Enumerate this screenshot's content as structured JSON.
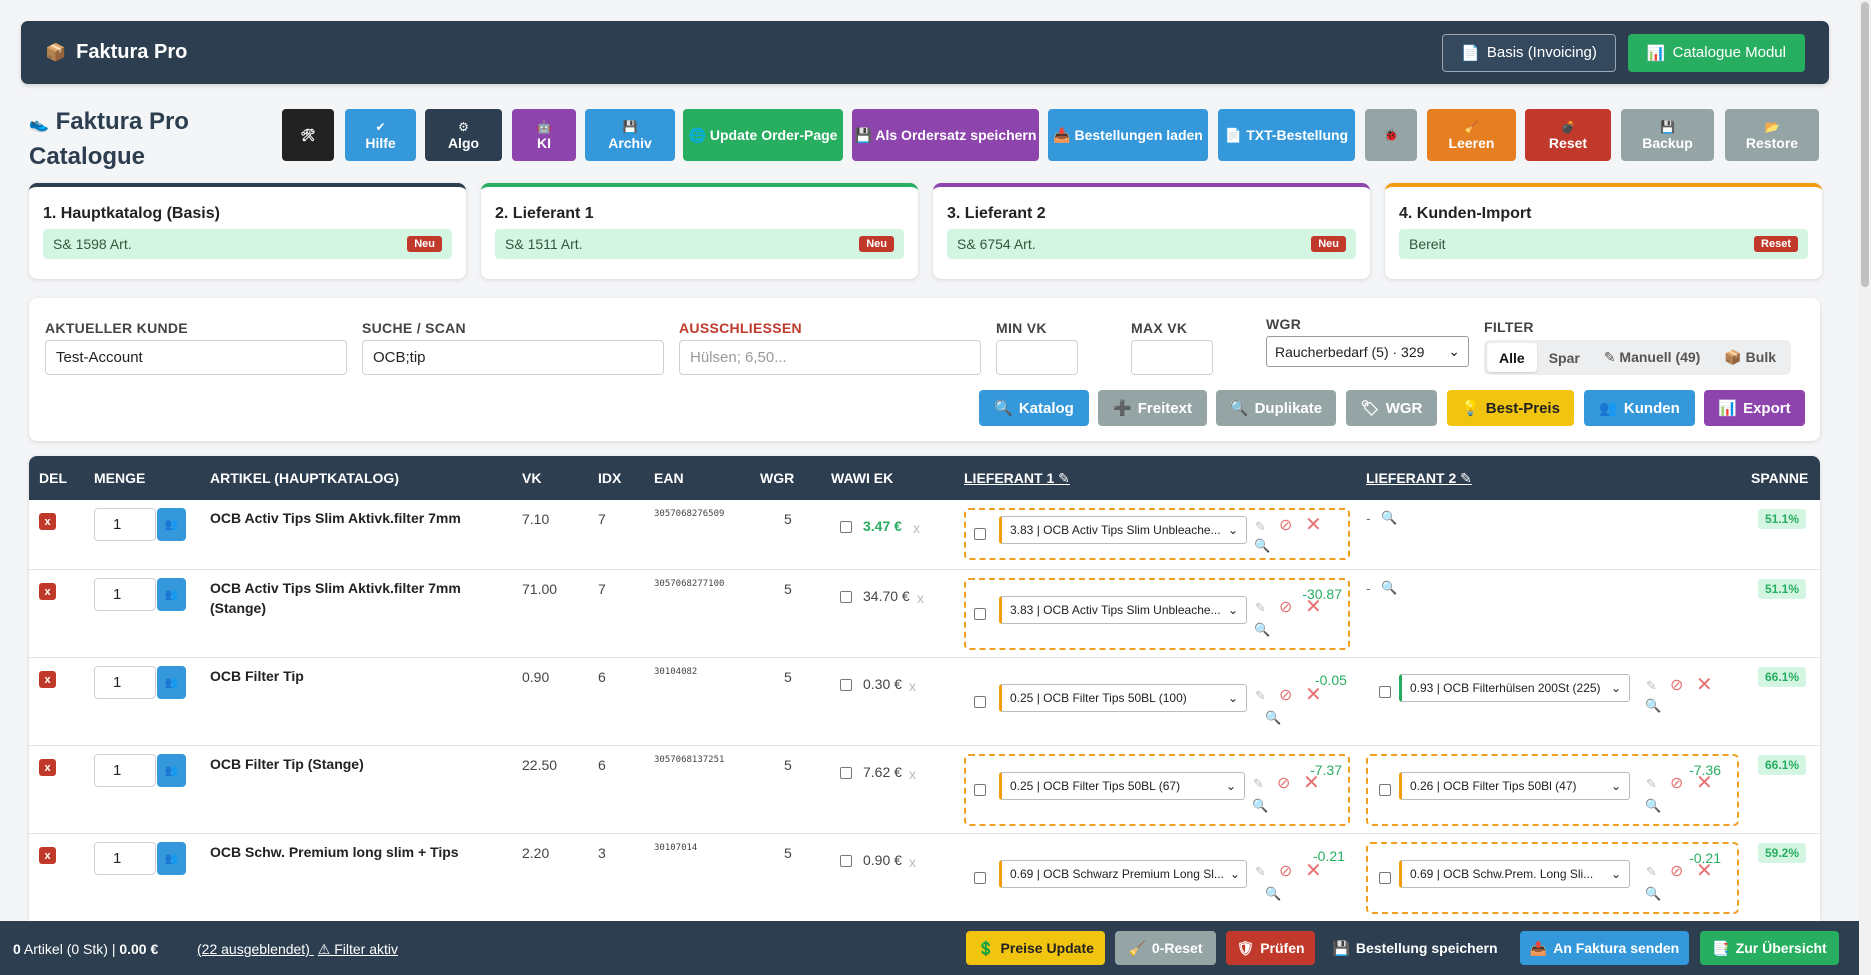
{
  "topbar": {
    "brand": "Faktura Pro",
    "brand_icon": "📦",
    "btn_basis": "Basis (Invoicing)",
    "btn_basis_icon": "📄",
    "btn_catalogue": "Catalogue Modul",
    "btn_catalogue_icon": "📊"
  },
  "title": {
    "line1": "Faktura Pro",
    "line2": "Catalogue",
    "icon": "👟"
  },
  "toolbar": [
    {
      "icon": "🛠",
      "label": "",
      "color": "#222222"
    },
    {
      "icon": "✔",
      "label": "Hilfe",
      "color": "#3498db"
    },
    {
      "icon": "⚙",
      "label": "Algo",
      "color": "#2c3e50"
    },
    {
      "icon": "🤖",
      "label": "KI",
      "color": "#8e44ad"
    },
    {
      "icon": "💾",
      "label": "Archiv",
      "color": "#3498db"
    },
    {
      "icon": "🌐",
      "label": "Update Order-Page",
      "color": "#27ae60"
    },
    {
      "icon": "💾",
      "label": "Als Ordersatz speichern",
      "color": "#8e44ad"
    },
    {
      "icon": "📥",
      "label": "Bestellungen laden",
      "color": "#3498db"
    },
    {
      "icon": "📄",
      "label": "TXT-Bestellung",
      "color": "#3498db"
    },
    {
      "icon": "🐞",
      "label": "",
      "color": "#95a5a6"
    },
    {
      "icon": "🧹",
      "label": "Leeren",
      "color": "#e67e22"
    },
    {
      "icon": "💣",
      "label": "Reset",
      "color": "#c0392b"
    },
    {
      "icon": "💾",
      "label": "Backup",
      "color": "#95a5a6"
    },
    {
      "icon": "📂",
      "label": "Restore",
      "color": "#95a5a6"
    }
  ],
  "cards": [
    {
      "title": "1. Hauptkatalog (Basis)",
      "status": "S& 1598 Art.",
      "badge": "Neu",
      "accent": "#2c3e50"
    },
    {
      "title": "2. Lieferant 1",
      "status": "S& 1511 Art.",
      "badge": "Neu",
      "accent": "#27ae60"
    },
    {
      "title": "3. Lieferant 2",
      "status": "S& 6754 Art.",
      "badge": "Neu",
      "accent": "#8e44ad"
    },
    {
      "title": "4. Kunden-Import",
      "status": "Bereit",
      "badge": "Reset",
      "accent": "#f39c12"
    }
  ],
  "filters": {
    "kunde_label": "AKTUELLER KUNDE",
    "kunde_value": "Test-Account",
    "suche_label": "SUCHE / SCAN",
    "suche_value": "OCB;tip",
    "ausschl_label": "AUSSCHLIESSEN",
    "ausschl_placeholder": "Hülsen; 6,50...",
    "minvk_label": "MIN VK",
    "maxvk_label": "MAX VK",
    "wgr_label": "WGR",
    "wgr_value": "Raucherbedarf (5) · 329",
    "filter_label": "FILTER",
    "filter_options": [
      "Alle",
      "Spar",
      "✎ Manuell (49)",
      "📦 Bulk"
    ]
  },
  "actions": [
    {
      "icon": "🔍",
      "label": "Katalog",
      "color": "#3498db"
    },
    {
      "icon": "➕",
      "label": "Freitext",
      "color": "#95a5a6"
    },
    {
      "icon": "🔍",
      "label": "Duplikate",
      "color": "#95a5a6"
    },
    {
      "icon": "🏷",
      "label": "WGR",
      "color": "#95a5a6"
    },
    {
      "icon": "💡",
      "label": "Best-Preis",
      "color": "#f1c40f"
    },
    {
      "icon": "👥",
      "label": "Kunden",
      "color": "#3498db"
    },
    {
      "icon": "📊",
      "label": "Export",
      "color": "#8e44ad"
    }
  ],
  "table": {
    "headers": {
      "del": "DEL",
      "menge": "MENGE",
      "artikel": "ARTIKEL (HAUPTKATALOG)",
      "vk": "VK",
      "idx": "IDX",
      "ean": "EAN",
      "wgr": "WGR",
      "wawi": "WAWI EK",
      "l1": "LIEFERANT 1 ✎",
      "l2": "LIEFERANT 2 ✎",
      "spanne": "SPANNE"
    },
    "rows": [
      {
        "qty": "1",
        "artikel": "OCB Activ Tips Slim Aktivk.filter 7mm",
        "vk": "7.10",
        "idx": "7",
        "ean": "3057068276509",
        "wgr": "5",
        "ek": "3.47 €",
        "ek_green": true,
        "l1": "3.83 | OCB Activ Tips Slim Unbleache...",
        "l1_diff": "",
        "l2": "",
        "l2_diff": "",
        "l2_empty": "-",
        "spanne": "51.1%"
      },
      {
        "qty": "1",
        "artikel": "OCB Activ Tips Slim Aktivk.filter 7mm (Stange)",
        "vk": "71.00",
        "idx": "7",
        "ean": "3057068277100",
        "wgr": "5",
        "ek": "34.70 €",
        "ek_green": false,
        "l1": "3.83 | OCB Activ Tips Slim Unbleache...",
        "l1_diff": "-30.87",
        "l2": "",
        "l2_diff": "",
        "l2_empty": "-",
        "spanne": "51.1%"
      },
      {
        "qty": "1",
        "artikel": "OCB Filter Tip",
        "vk": "0.90",
        "idx": "6",
        "ean": "30104082",
        "wgr": "5",
        "ek": "0.30 €",
        "ek_green": false,
        "l1": "0.25 | OCB Filter Tips 50BL (100)",
        "l1_diff": "-0.05",
        "l2": "0.93 | OCB Filterhülsen 200St (225)",
        "l2_diff": "",
        "l2_empty": "",
        "spanne": "66.1%"
      },
      {
        "qty": "1",
        "artikel": "OCB Filter Tip (Stange)",
        "vk": "22.50",
        "idx": "6",
        "ean": "3057068137251",
        "wgr": "5",
        "ek": "7.62 €",
        "ek_green": false,
        "l1": "0.25 | OCB Filter Tips 50BL (67)",
        "l1_diff": "-7.37",
        "l2": "0.26 | OCB Filter Tips 50Bl (47)",
        "l2_diff": "-7.36",
        "l2_empty": "",
        "spanne": "66.1%"
      },
      {
        "qty": "1",
        "artikel": "OCB Schw. Premium long slim + Tips",
        "vk": "2.20",
        "idx": "3",
        "ean": "30107014",
        "wgr": "5",
        "ek": "0.90 €",
        "ek_green": false,
        "l1": "0.69 | OCB Schwarz Premium Long Sl...",
        "l1_diff": "-0.21",
        "l2": "0.69 | OCB Schw.Prem. Long Sli...",
        "l2_diff": "-0.21",
        "l2_empty": "",
        "spanne": "59.2%"
      }
    ]
  },
  "footer": {
    "summary_count": "0",
    "summary_rest": " Artikel (0 Stk) | ",
    "summary_total": "0.00 €",
    "hidden": "(22 ausgeblendet)",
    "filter_warn": "⚠ Filter aktiv",
    "buttons": [
      {
        "icon": "💲",
        "label": "Preise Update",
        "color": "#f1c40f"
      },
      {
        "icon": "🧹",
        "label": "0-Reset",
        "color": "#95a5a6"
      },
      {
        "icon": "🛡",
        "label": "Prüfen",
        "color": "#c0392b"
      },
      {
        "icon": "💾",
        "label": "Bestellung speichern",
        "color": "#2c3e50"
      },
      {
        "icon": "📤",
        "label": "An Faktura senden",
        "color": "#3498db"
      },
      {
        "icon": "📑",
        "label": "Zur Übersicht",
        "color": "#27ae60"
      }
    ]
  }
}
